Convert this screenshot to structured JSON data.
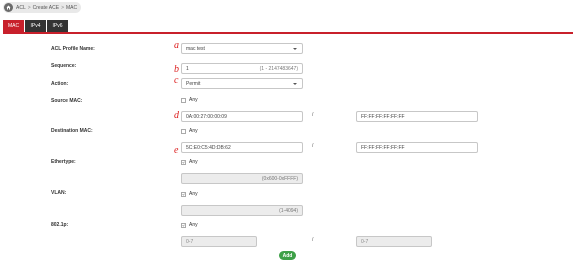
{
  "breadcrumb": {
    "items": [
      "ACL",
      "Create ACE",
      "MAC"
    ],
    "separator": ">"
  },
  "tabs": [
    {
      "label": "MAC",
      "active": true
    },
    {
      "label": "IPv4",
      "active": false
    },
    {
      "label": "IPv6",
      "active": false
    }
  ],
  "form": {
    "profile": {
      "label": "ACL Profile Name:",
      "value": "mac test",
      "marker": "a"
    },
    "sequence": {
      "label": "Sequence:",
      "value": "1",
      "range": "(1 - 2147483647)",
      "marker": "b"
    },
    "action": {
      "label": "Action:",
      "value": "Permit",
      "marker": "c"
    },
    "source_mac": {
      "label": "Source MAC:",
      "any_label": "Any",
      "any_checked": false,
      "mac": "0A:00:27:00:00:09",
      "mask": "FF:FF:FF:FF:FF:FF",
      "marker": "d"
    },
    "dest_mac": {
      "label": "Destination MAC:",
      "any_label": "Any",
      "any_checked": false,
      "mac": "5C:E0:C5:4D:DB:62",
      "mask": "FF:FF:FF:FF:FF:FF",
      "marker": "e"
    },
    "ethertype": {
      "label": "Ethertype:",
      "any_label": "Any",
      "any_checked": true,
      "range": "(0x600-0xFFFF)"
    },
    "vlan": {
      "label": "VLAN:",
      "any_label": "Any",
      "any_checked": true,
      "range": "(1-4094)"
    },
    "dot1p": {
      "label": "802.1p:",
      "any_label": "Any",
      "any_checked": true,
      "placeholder1": "0-7",
      "placeholder2": "0-7"
    },
    "slash": "/"
  },
  "buttons": {
    "add": "Add"
  },
  "colors": {
    "accent": "#c8202b",
    "button": "#3ea048",
    "marker": "#dd2222"
  }
}
